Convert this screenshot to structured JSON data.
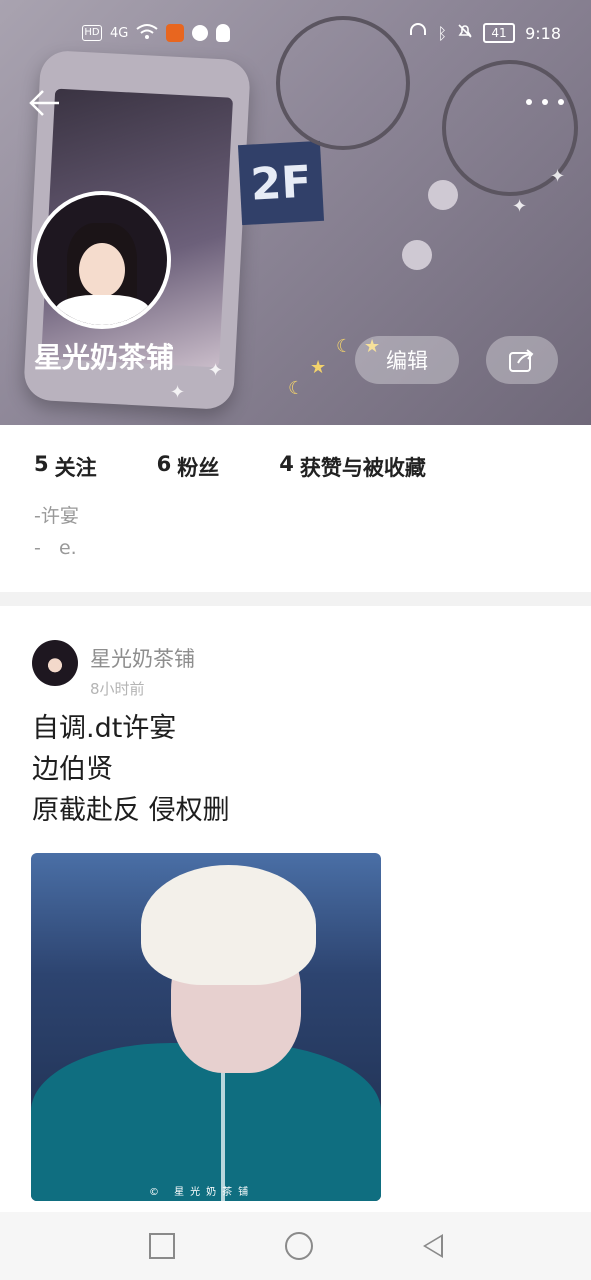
{
  "statusbar": {
    "left_icons": [
      "hd-icon",
      "4g-signal-icon",
      "wifi-icon",
      "app-notification-icon",
      "vpn-icon",
      "qq-icon"
    ],
    "hd_label": "HD",
    "network": "4G",
    "battery": "41",
    "time": "9:18"
  },
  "header": {
    "back_icon": "arrow-left",
    "more_icon": "three-dots",
    "profile_name": "星光奶茶铺",
    "edit_label": "编辑",
    "share_icon": "share-arrow",
    "decor_text": "2F"
  },
  "stats": [
    {
      "number": "5",
      "label": "关注"
    },
    {
      "number": "6",
      "label": "粉丝"
    },
    {
      "number": "4",
      "label": "获赞与被收藏"
    }
  ],
  "bio": [
    "-许宴",
    "-   e."
  ],
  "post": {
    "author": "星光奶茶铺",
    "time": "8小时前",
    "lines": [
      "自调.dt许宴",
      "边伯贤",
      "原截赴反 侵权删"
    ],
    "image_watermark": "© 星光奶茶铺"
  },
  "navbar": {
    "icons": [
      "recent-apps-square",
      "home-circle",
      "back-triangle"
    ]
  },
  "colors": {
    "header_bg": "#8d8697",
    "text_primary": "#1e1e1e",
    "text_secondary": "#999999",
    "divider": "#f2f2f2"
  }
}
